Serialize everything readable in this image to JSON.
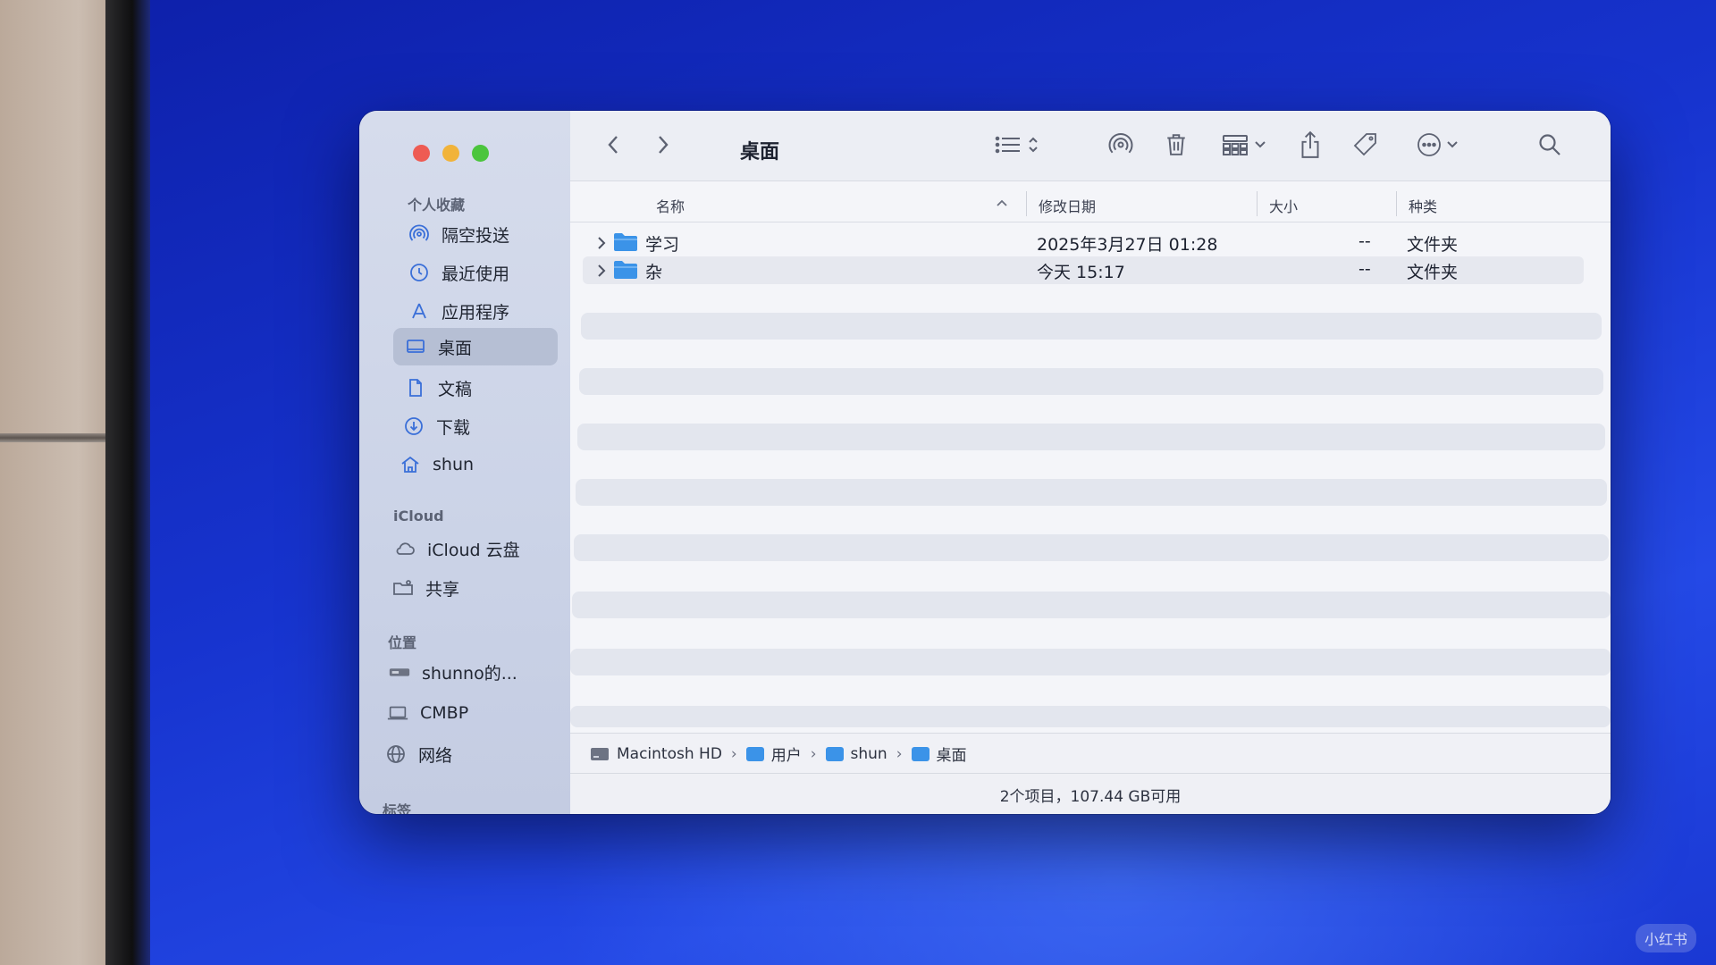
{
  "window": {
    "title": "桌面"
  },
  "sidebar": {
    "favorites_title": "个人收藏",
    "favorites": [
      {
        "label": "隔空投送",
        "icon": "airdrop-icon"
      },
      {
        "label": "最近使用",
        "icon": "clock-icon"
      },
      {
        "label": "应用程序",
        "icon": "applications-icon"
      },
      {
        "label": "桌面",
        "icon": "desktop-icon",
        "selected": true
      },
      {
        "label": "文稿",
        "icon": "document-icon"
      },
      {
        "label": "下载",
        "icon": "download-icon"
      },
      {
        "label": "shun",
        "icon": "home-icon"
      }
    ],
    "icloud_title": "iCloud",
    "icloud": [
      {
        "label": "iCloud 云盘",
        "icon": "cloud-icon"
      },
      {
        "label": "共享",
        "icon": "shared-folder-icon"
      }
    ],
    "locations_title": "位置",
    "locations": [
      {
        "label": "shunno的...",
        "icon": "drive-icon"
      },
      {
        "label": "CMBP",
        "icon": "laptop-icon"
      },
      {
        "label": "网络",
        "icon": "globe-icon"
      }
    ],
    "tags_title": "标签"
  },
  "columns": {
    "name": "名称",
    "date": "修改日期",
    "size": "大小",
    "kind": "种类"
  },
  "files": [
    {
      "name": "学习",
      "date": "2025年3月27日 01:28",
      "size": "--",
      "kind": "文件夹"
    },
    {
      "name": "杂",
      "date": "今天 15:17",
      "size": "--",
      "kind": "文件夹"
    }
  ],
  "path": [
    "Macintosh HD",
    "用户",
    "shun",
    "桌面"
  ],
  "status": "2个项目，107.44 GB可用",
  "watermark": "小红书",
  "colors": {
    "accent": "#3b93e8",
    "desktop_blue": "#1c39d6",
    "selected_row": "#b6bfd4"
  }
}
